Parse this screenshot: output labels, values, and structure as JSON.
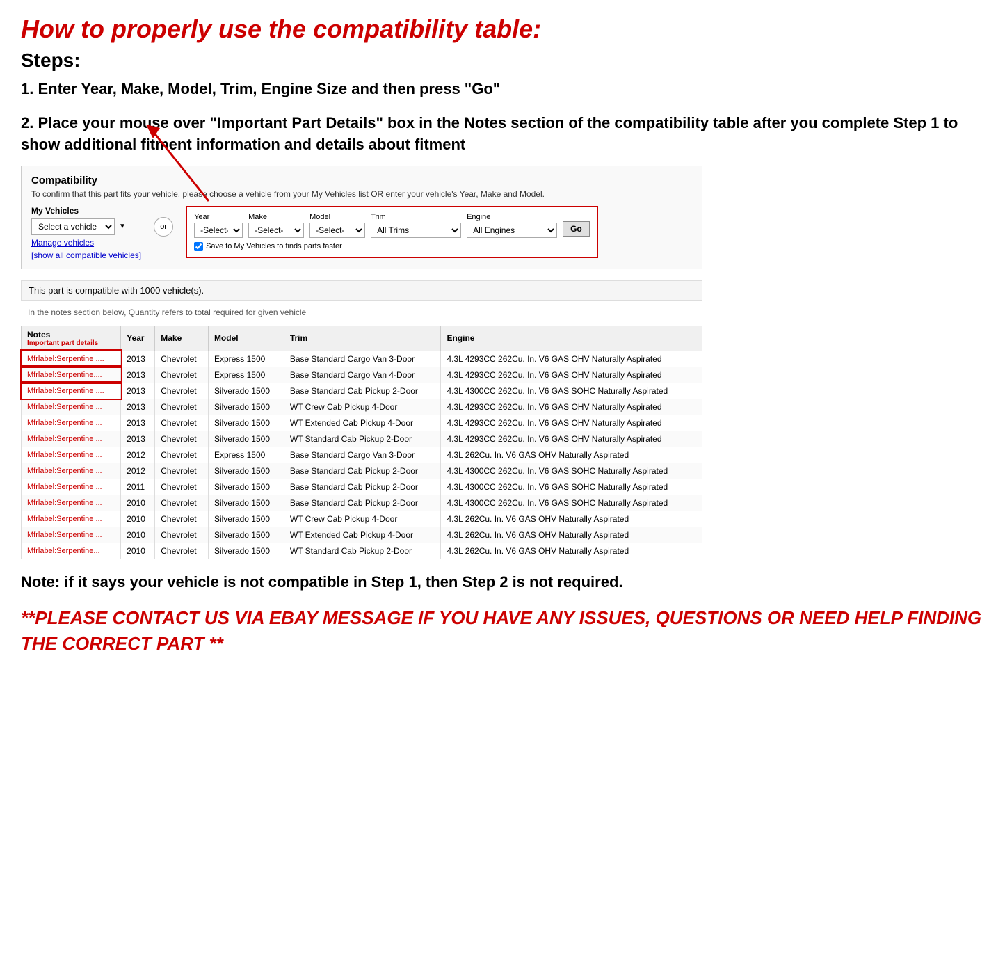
{
  "mainTitle": "How to properly use the compatibility table:",
  "stepsTitle": "Steps:",
  "step1": "1. Enter Year, Make, Model, Trim, Engine Size and then press \"Go\"",
  "step2": "2. Place your mouse over \"Important Part Details\" box in the Notes section of the compatibility table after you complete Step 1 to show additional fitment information and details about fitment",
  "note": "Note: if it says your vehicle is not compatible in Step 1, then Step 2 is not required.",
  "contact": "**PLEASE CONTACT US VIA EBAY MESSAGE IF YOU HAVE ANY ISSUES, QUESTIONS OR NEED HELP FINDING THE CORRECT PART **",
  "compatibility": {
    "header": "Compatibility",
    "subtext": "To confirm that this part fits your vehicle, please choose a vehicle from your My Vehicles list OR enter your vehicle's Year, Make and Model.",
    "myVehiclesLabel": "My Vehicles",
    "selectVehiclePlaceholder": "Select a vehicle",
    "manageLinkText": "Manage vehicles",
    "showAllLinkText": "[show all compatible vehicles]",
    "orLabel": "or",
    "yearLabel": "Year",
    "makeLabel": "Make",
    "modelLabel": "Model",
    "trimLabel": "Trim",
    "engineLabel": "Engine",
    "yearDefault": "-Select-",
    "makeDefault": "-Select-",
    "modelDefault": "-Select-",
    "trimDefault": "All Trims",
    "engineDefault": "All Engines",
    "goButtonLabel": "Go",
    "saveCheckboxLabel": "Save to My Vehicles to finds parts faster",
    "compatibleCount": "This part is compatible with 1000 vehicle(s).",
    "quantityNote": "In the notes section below, Quantity refers to total required for given vehicle",
    "tableHeaders": {
      "notes": "Notes",
      "notesSub": "Important part details",
      "year": "Year",
      "make": "Make",
      "model": "Model",
      "trim": "Trim",
      "engine": "Engine"
    },
    "rows": [
      {
        "notes": "Mfrlabel:Serpentine ....",
        "year": "2013",
        "make": "Chevrolet",
        "model": "Express 1500",
        "trim": "Base Standard Cargo Van 3-Door",
        "engine": "4.3L 4293CC 262Cu. In. V6 GAS OHV Naturally Aspirated",
        "highlight": true
      },
      {
        "notes": "Mfrlabel:Serpentine....",
        "year": "2013",
        "make": "Chevrolet",
        "model": "Express 1500",
        "trim": "Base Standard Cargo Van 4-Door",
        "engine": "4.3L 4293CC 262Cu. In. V6 GAS OHV Naturally Aspirated",
        "highlight": true
      },
      {
        "notes": "Mfrlabel:Serpentine ....",
        "year": "2013",
        "make": "Chevrolet",
        "model": "Silverado 1500",
        "trim": "Base Standard Cab Pickup 2-Door",
        "engine": "4.3L 4300CC 262Cu. In. V6 GAS SOHC Naturally Aspirated",
        "highlight": true
      },
      {
        "notes": "Mfrlabel:Serpentine ...",
        "year": "2013",
        "make": "Chevrolet",
        "model": "Silverado 1500",
        "trim": "WT Crew Cab Pickup 4-Door",
        "engine": "4.3L 4293CC 262Cu. In. V6 GAS OHV Naturally Aspirated",
        "highlight": false
      },
      {
        "notes": "Mfrlabel:Serpentine ...",
        "year": "2013",
        "make": "Chevrolet",
        "model": "Silverado 1500",
        "trim": "WT Extended Cab Pickup 4-Door",
        "engine": "4.3L 4293CC 262Cu. In. V6 GAS OHV Naturally Aspirated",
        "highlight": false
      },
      {
        "notes": "Mfrlabel:Serpentine ...",
        "year": "2013",
        "make": "Chevrolet",
        "model": "Silverado 1500",
        "trim": "WT Standard Cab Pickup 2-Door",
        "engine": "4.3L 4293CC 262Cu. In. V6 GAS OHV Naturally Aspirated",
        "highlight": false
      },
      {
        "notes": "Mfrlabel:Serpentine ...",
        "year": "2012",
        "make": "Chevrolet",
        "model": "Express 1500",
        "trim": "Base Standard Cargo Van 3-Door",
        "engine": "4.3L 262Cu. In. V6 GAS OHV Naturally Aspirated",
        "highlight": false
      },
      {
        "notes": "Mfrlabel:Serpentine ...",
        "year": "2012",
        "make": "Chevrolet",
        "model": "Silverado 1500",
        "trim": "Base Standard Cab Pickup 2-Door",
        "engine": "4.3L 4300CC 262Cu. In. V6 GAS SOHC Naturally Aspirated",
        "highlight": false
      },
      {
        "notes": "Mfrlabel:Serpentine ...",
        "year": "2011",
        "make": "Chevrolet",
        "model": "Silverado 1500",
        "trim": "Base Standard Cab Pickup 2-Door",
        "engine": "4.3L 4300CC 262Cu. In. V6 GAS SOHC Naturally Aspirated",
        "highlight": false
      },
      {
        "notes": "Mfrlabel:Serpentine ...",
        "year": "2010",
        "make": "Chevrolet",
        "model": "Silverado 1500",
        "trim": "Base Standard Cab Pickup 2-Door",
        "engine": "4.3L 4300CC 262Cu. In. V6 GAS SOHC Naturally Aspirated",
        "highlight": false
      },
      {
        "notes": "Mfrlabel:Serpentine ...",
        "year": "2010",
        "make": "Chevrolet",
        "model": "Silverado 1500",
        "trim": "WT Crew Cab Pickup 4-Door",
        "engine": "4.3L 262Cu. In. V6 GAS OHV Naturally Aspirated",
        "highlight": false
      },
      {
        "notes": "Mfrlabel:Serpentine ...",
        "year": "2010",
        "make": "Chevrolet",
        "model": "Silverado 1500",
        "trim": "WT Extended Cab Pickup 4-Door",
        "engine": "4.3L 262Cu. In. V6 GAS OHV Naturally Aspirated",
        "highlight": false
      },
      {
        "notes": "Mfrlabel:Serpentine...",
        "year": "2010",
        "make": "Chevrolet",
        "model": "Silverado 1500",
        "trim": "WT Standard Cab Pickup 2-Door",
        "engine": "4.3L 262Cu. In. V6 GAS OHV Naturally Aspirated",
        "highlight": false
      }
    ]
  }
}
